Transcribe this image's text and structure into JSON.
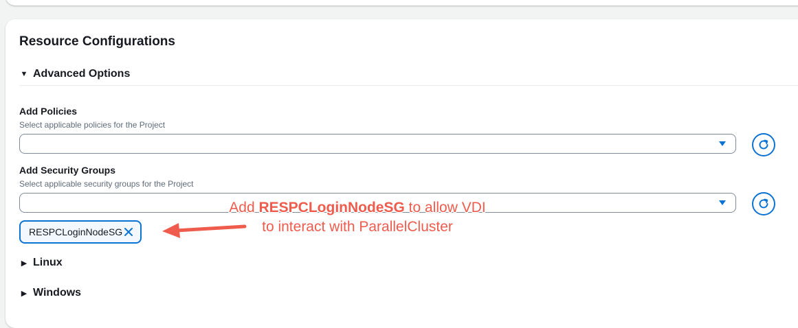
{
  "card": {
    "title": "Resource Configurations"
  },
  "advanced": {
    "toggle": "▼",
    "label": "Advanced Options"
  },
  "policies": {
    "label": "Add Policies",
    "description": "Select applicable policies for the Project",
    "value": ""
  },
  "security_groups": {
    "label": "Add Security Groups",
    "description": "Select applicable security groups for the Project",
    "value": "",
    "tokens": [
      "RESPCLoginNodeSG"
    ]
  },
  "annotation": {
    "line1_prefix": "Add ",
    "line1_bold": "RESPCLoginNodeSG",
    "line1_suffix": " to allow VDI",
    "line2": "to interact with ParallelCluster",
    "color": "#ef5b4c"
  },
  "sections": {
    "linux": {
      "toggle": "▶",
      "label": "Linux"
    },
    "windows": {
      "toggle": "▶",
      "label": "Windows"
    }
  },
  "icons": {
    "dropdown": "caret-down-icon",
    "refresh": "refresh-icon",
    "remove": "close-icon"
  },
  "colors": {
    "accent": "#0972d3",
    "annotation": "#ef5b4c"
  }
}
